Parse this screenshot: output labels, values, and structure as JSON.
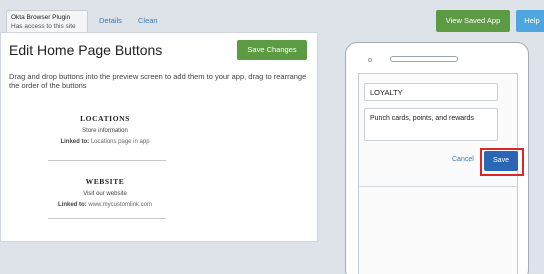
{
  "extension": {
    "title": "Okta Browser Plugin",
    "subtitle": "Has access to this site"
  },
  "top_nav": {
    "details": "Details",
    "clean": "Clean"
  },
  "header": {
    "view_saved": "View Saved App",
    "help": "Help"
  },
  "editor": {
    "title": "Edit Home Page Buttons",
    "save_changes": "Save Changes",
    "instructions": "Drag and drop buttons into the preview screen to add them to your app, drag to rearrange the order of the buttons",
    "buttons": [
      {
        "title": "LOCATIONS",
        "subtitle": "Store information",
        "link_label": "Linked to:",
        "link_value": "Locations page in app"
      },
      {
        "title": "WEBSITE",
        "subtitle": "Visit our website",
        "link_label": "Linked to:",
        "link_value": "www.mycustomlink.com"
      }
    ]
  },
  "phone": {
    "title_field": "LOYALTY",
    "desc_field": "Punch cards, points, and rewards",
    "cancel": "Cancel",
    "save": "Save"
  },
  "colors": {
    "green": "#5c9b43",
    "blue": "#2a66b3",
    "help_blue": "#4da6df",
    "highlight_red": "#d8262a"
  }
}
